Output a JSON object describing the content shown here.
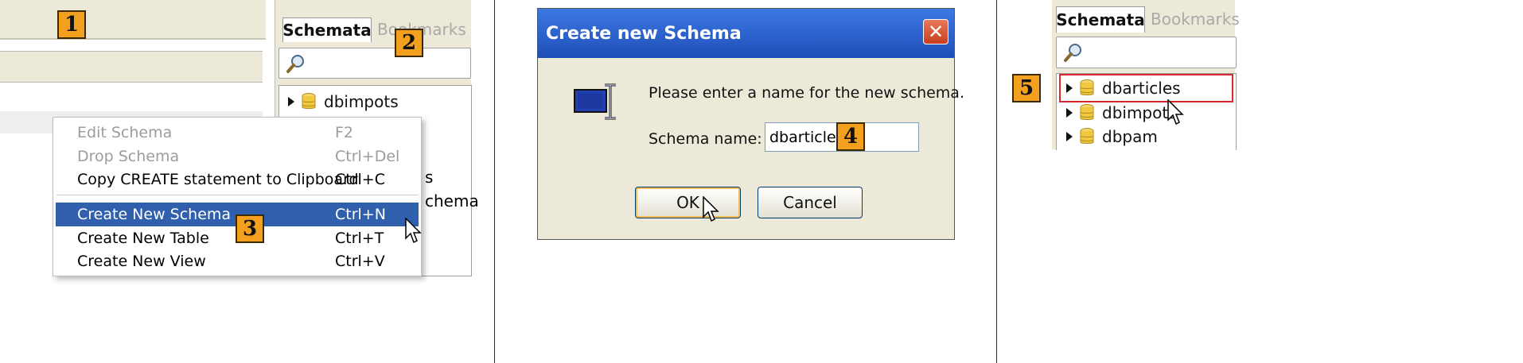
{
  "panel1": {
    "tabs": {
      "schemata": "Schemata",
      "bookmarks": "Bookmarks"
    },
    "tree": [
      "dbimpots",
      "s",
      "chema"
    ],
    "menu": [
      {
        "label": "Edit Schema",
        "shortcut": "F2",
        "state": "disabled"
      },
      {
        "label": "Drop Schema",
        "shortcut": "Ctrl+Del",
        "state": "disabled"
      },
      {
        "label": "Copy CREATE statement to Clipboard",
        "shortcut": "Ctrl+C",
        "state": "enabled"
      },
      {
        "label": "Create New Schema",
        "shortcut": "Ctrl+N",
        "state": "selected"
      },
      {
        "label": "Create New Table",
        "shortcut": "Ctrl+T",
        "state": "enabled"
      },
      {
        "label": "Create New View",
        "shortcut": "Ctrl+V",
        "state": "enabled"
      }
    ],
    "badges": [
      "1",
      "2",
      "3"
    ]
  },
  "panel2": {
    "title": "Create new Schema",
    "message": "Please enter a name for the new schema.",
    "field_label": "Schema name:",
    "field_value": "dbarticles",
    "ok": "OK",
    "cancel": "Cancel",
    "badge": "4"
  },
  "panel3": {
    "tabs": {
      "schemata": "Schemata",
      "bookmarks": "Bookmarks"
    },
    "tree": [
      "dbarticles",
      "dbimpots",
      "dbpam"
    ],
    "badge": "5"
  },
  "colors": {
    "accent": "#f3a01e",
    "selection": "#2f5fad",
    "title_bar": "#2a5bc8",
    "highlight_border": "#d9272e"
  }
}
